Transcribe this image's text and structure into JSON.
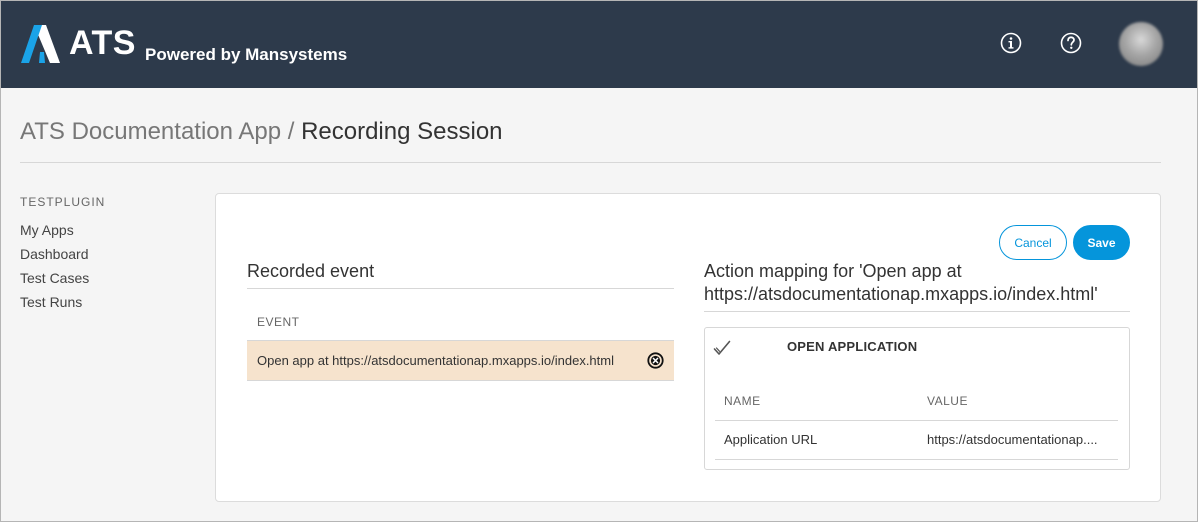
{
  "header": {
    "logo_text": "ATS",
    "logo_subtitle": "Powered by Mansystems",
    "icons": [
      "info-icon",
      "help-icon"
    ],
    "brand_color": "#2d3a4b",
    "accent_color": "#1aa3e8"
  },
  "breadcrumb": {
    "app": "ATS Documentation App",
    "separator": "/",
    "page": "Recording Session"
  },
  "sidebar": {
    "header": "TESTPLUGIN",
    "items": [
      {
        "label": "My Apps"
      },
      {
        "label": "Dashboard"
      },
      {
        "label": "Test Cases"
      },
      {
        "label": "Test Runs"
      }
    ]
  },
  "actions": {
    "cancel_label": "Cancel",
    "save_label": "Save",
    "primary_color": "#0595db"
  },
  "recorded_event": {
    "title": "Recorded event",
    "column_header": "EVENT",
    "events": [
      {
        "text": "Open app at https://atsdocumentationap.mxapps.io/index.html",
        "selected": true
      }
    ],
    "selected_color": "#f6e3cd"
  },
  "action_mapping": {
    "title_line1": "Action mapping for 'Open app at",
    "title_line2": "https://atsdocumentationap.mxapps.io/index.html'",
    "action_name": "OPEN APPLICATION",
    "columns": {
      "name": "NAME",
      "value": "VALUE"
    },
    "rows": [
      {
        "name": "Application URL",
        "value": "https://atsdocumentationap...."
      }
    ]
  }
}
